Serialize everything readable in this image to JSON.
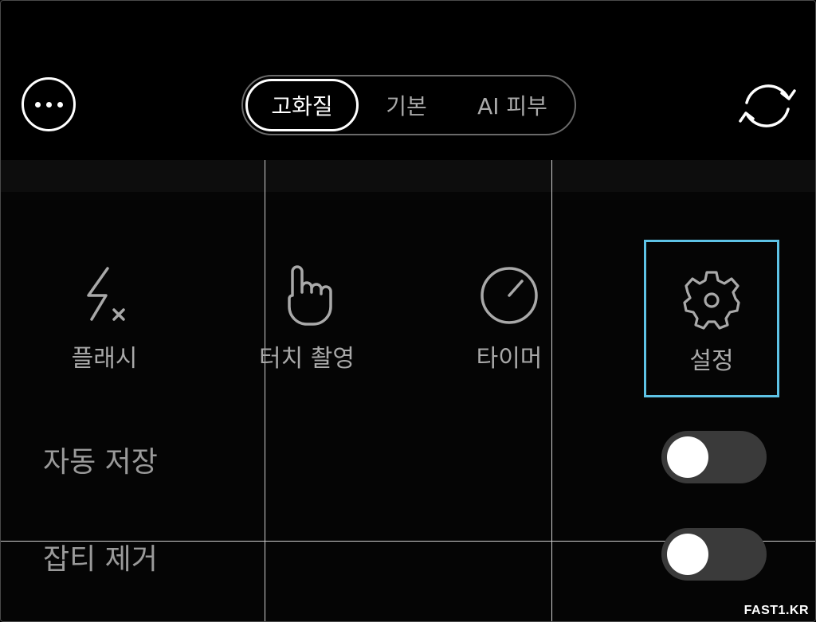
{
  "top_bar": {
    "more_icon": "more-horizontal-icon",
    "flip_icon": "camera-flip-icon",
    "modes": [
      {
        "label": "고화질",
        "selected": true
      },
      {
        "label": "기본",
        "selected": false
      },
      {
        "label": "AI 피부",
        "selected": false
      }
    ]
  },
  "quick_settings": [
    {
      "label": "플래시",
      "icon": "flash-off-icon",
      "selected": false
    },
    {
      "label": "터치 촬영",
      "icon": "touch-hand-icon",
      "selected": false
    },
    {
      "label": "타이머",
      "icon": "timer-icon",
      "selected": false
    },
    {
      "label": "설정",
      "icon": "gear-icon",
      "selected": true
    }
  ],
  "toggles": [
    {
      "label": "자동 저장",
      "on": false
    },
    {
      "label": "잡티 제거",
      "on": false
    }
  ],
  "colors": {
    "background": "#000000",
    "accent_selection": "#5ec3e6",
    "toggle_track_off": "#3a3a3a"
  },
  "watermark": "FAST1.KR"
}
